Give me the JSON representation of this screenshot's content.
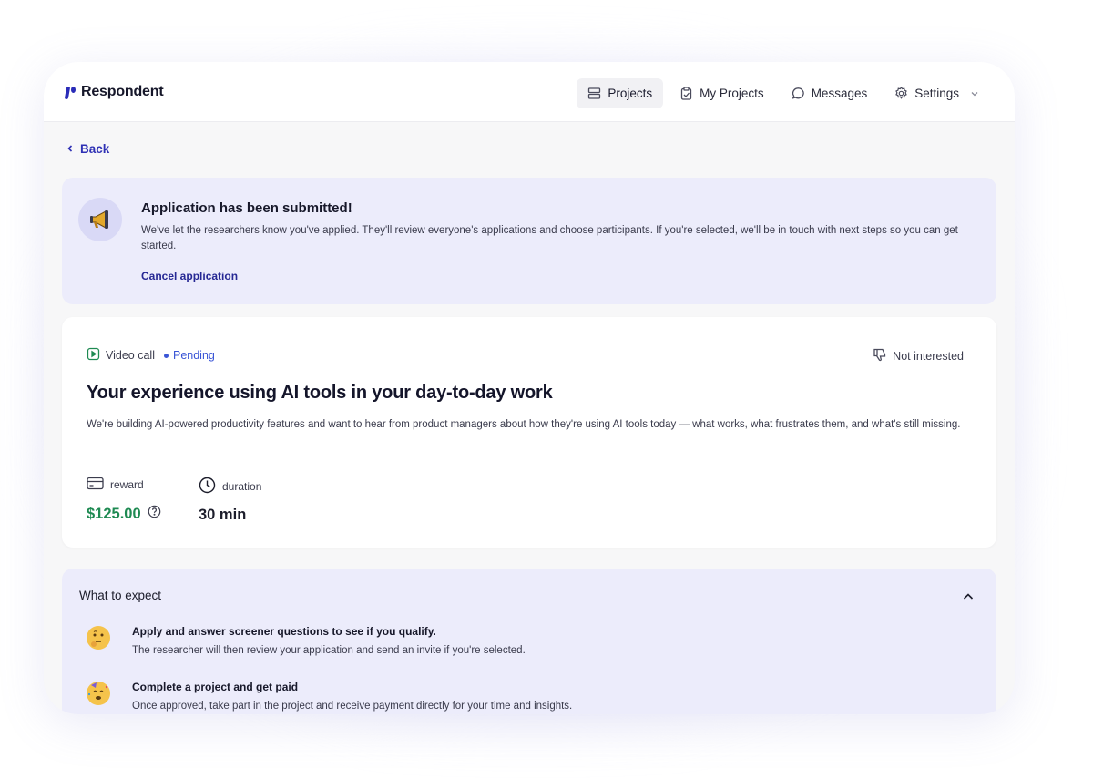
{
  "app": {
    "name": "Respondent"
  },
  "nav": {
    "items": [
      {
        "label": "Projects",
        "icon": "projects-icon",
        "active": true
      },
      {
        "label": "My Projects",
        "icon": "clipboard-icon",
        "active": false
      },
      {
        "label": "Messages",
        "icon": "chat-bubble-icon",
        "active": false
      },
      {
        "label": "Settings",
        "icon": "gear-icon",
        "active": false
      }
    ]
  },
  "back": {
    "label": "Back"
  },
  "notice": {
    "title": "Application has been submitted!",
    "body": "We've let the researchers know you've applied. They'll review everyone's applications and choose participants. If you're selected, we'll be in touch with next steps so you can get started.",
    "cancel_label": "Cancel application"
  },
  "project": {
    "type": "Video call",
    "status": "Pending",
    "not_interested_label": "Not interested",
    "title": "Your experience using AI tools in your day-to-day work",
    "description": "We're building AI-powered productivity features and want to hear from product managers about how they're using AI tools today — what works, what frustrates them, and what's still missing.",
    "reward_label": "reward",
    "reward_value": "$125.00",
    "duration_label": "duration",
    "duration_value": "30 min"
  },
  "expect": {
    "title": "What to expect",
    "steps": [
      {
        "title": "Apply and answer screener questions to see if you qualify.",
        "desc": "The researcher will then review your application and send an invite if you're selected.",
        "icon": "thinking-face-icon"
      },
      {
        "title": "Complete a project and get paid",
        "desc": "Once approved, take part in the project and receive payment directly for your time and insights.",
        "icon": "party-face-icon"
      }
    ]
  },
  "colors": {
    "accent": "#2f31b5",
    "reward_green": "#1e8a52",
    "pending_blue": "#3a55d6",
    "banner_bg": "#ececfb"
  }
}
